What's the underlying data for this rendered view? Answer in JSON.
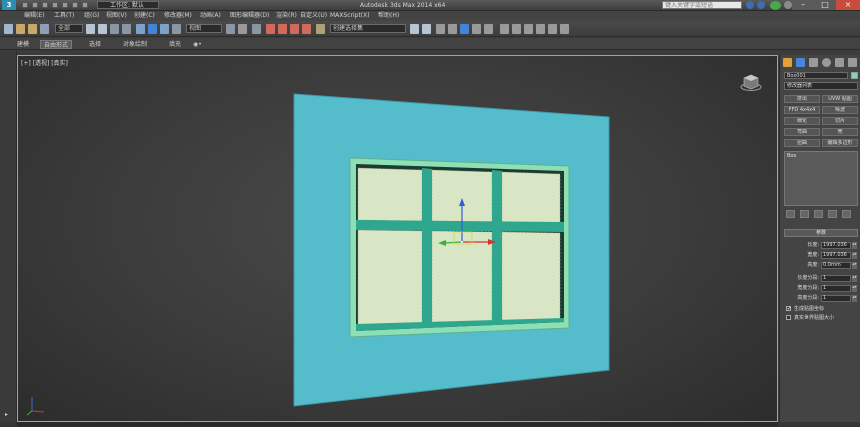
{
  "app": {
    "logo": "3",
    "title": "Autodesk 3ds Max 2014 x64",
    "workspace": "工作区: 默认",
    "search_placeholder": "键入关键字或短语"
  },
  "menu": {
    "items": [
      "编辑(E)",
      "工具(T)",
      "组(G)",
      "视图(V)",
      "创建(C)",
      "修改器(M)",
      "动画(A)",
      "图形编辑器(D)",
      "渲染(R)",
      "自定义(U)",
      "MAXScript(X)",
      "帮助(H)"
    ]
  },
  "toolbar": {
    "filter_combo": "全部",
    "view_combo": "视图",
    "selection_set_combo": "创建选择集"
  },
  "ribbon": {
    "tabs": [
      "建模",
      "自由形式",
      "选择",
      "对象绘制",
      "填充"
    ],
    "active_index": 1,
    "extra_label": "◉•"
  },
  "viewport": {
    "label": "[+] [透视] [真实]"
  },
  "command_panel": {
    "object_name": "Box001",
    "object_type": "修改器列表",
    "buttons": [
      "挤出",
      "UVW 贴图",
      "FFD 4x4x4",
      "噪波",
      "细化",
      "切片",
      "弯曲",
      "壳",
      "扭曲",
      "编辑多边形"
    ],
    "stack_item": "Box",
    "params_title": "参数",
    "params": [
      {
        "label": "长度:",
        "value": "1997.036"
      },
      {
        "label": "宽度:",
        "value": "1997.036"
      },
      {
        "label": "高度:",
        "value": "0.0mm"
      },
      {
        "label": "长度分段:",
        "value": "1"
      },
      {
        "label": "宽度分段:",
        "value": "1"
      },
      {
        "label": "高度分段:",
        "value": "1"
      }
    ],
    "checks": [
      {
        "label": "生成贴图坐标",
        "checked": "✔"
      },
      {
        "label": "真实世界贴图大小",
        "checked": ""
      }
    ]
  }
}
